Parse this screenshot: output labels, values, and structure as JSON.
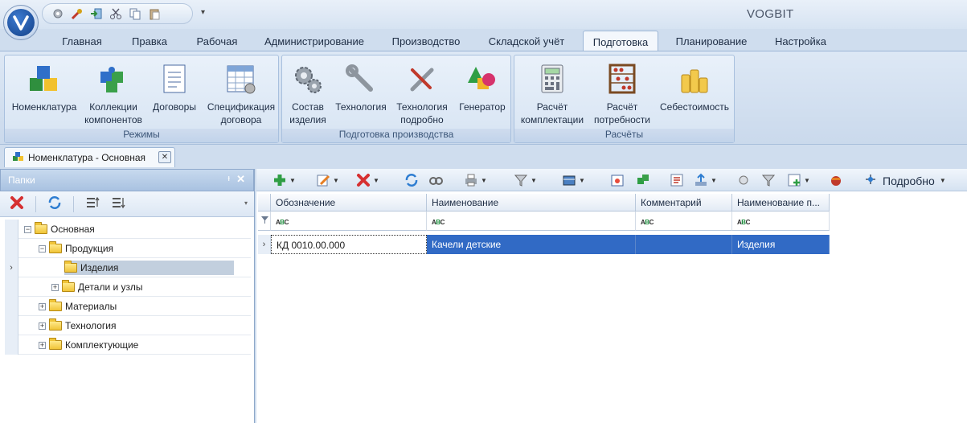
{
  "app": {
    "title": "VOGBIT"
  },
  "ribbon": {
    "tabs": [
      "Главная",
      "Правка",
      "Рабочая",
      "Администрирование",
      "Производство",
      "Складской учёт",
      "Подготовка",
      "Планирование",
      "Настройка"
    ],
    "active_tab": "Подготовка",
    "groups": [
      {
        "label": "Режимы",
        "buttons": [
          "Номенклатура",
          "Коллекции компонентов",
          "Договоры",
          "Спецификация договора"
        ]
      },
      {
        "label": "Подготовка производства",
        "buttons": [
          "Состав изделия",
          "Технология",
          "Технология подробно",
          "Генератор"
        ]
      },
      {
        "label": "Расчёты",
        "buttons": [
          "Расчёт комплектации",
          "Расчёт потребности",
          "Себестоимость"
        ]
      }
    ]
  },
  "document_tab": {
    "label": "Номенклатура - Основная",
    "close": "✕"
  },
  "folders": {
    "title": "Папки",
    "tree": [
      {
        "label": "Основная",
        "level": 0,
        "expander": "−"
      },
      {
        "label": "Продукция",
        "level": 1,
        "expander": "−"
      },
      {
        "label": "Изделия",
        "level": 2,
        "expander": "",
        "selected": true
      },
      {
        "label": "Детали и узлы",
        "level": 2,
        "expander": "+"
      },
      {
        "label": "Материалы",
        "level": 1,
        "expander": "+"
      },
      {
        "label": "Технология",
        "level": 1,
        "expander": "+"
      },
      {
        "label": "Комплектующие",
        "level": 1,
        "expander": "+"
      }
    ]
  },
  "grid": {
    "toolbar": {
      "detail_label": "Подробно"
    },
    "columns": [
      "Обозначение",
      "Наименование",
      "Комментарий",
      "Наименование п..."
    ],
    "rows": [
      {
        "cells": [
          "КД 0010.00.000",
          "Качели детские",
          "",
          "Изделия"
        ]
      }
    ]
  },
  "colors": {
    "selection": "#316ac5",
    "ribbon": "#d7e4f3"
  }
}
